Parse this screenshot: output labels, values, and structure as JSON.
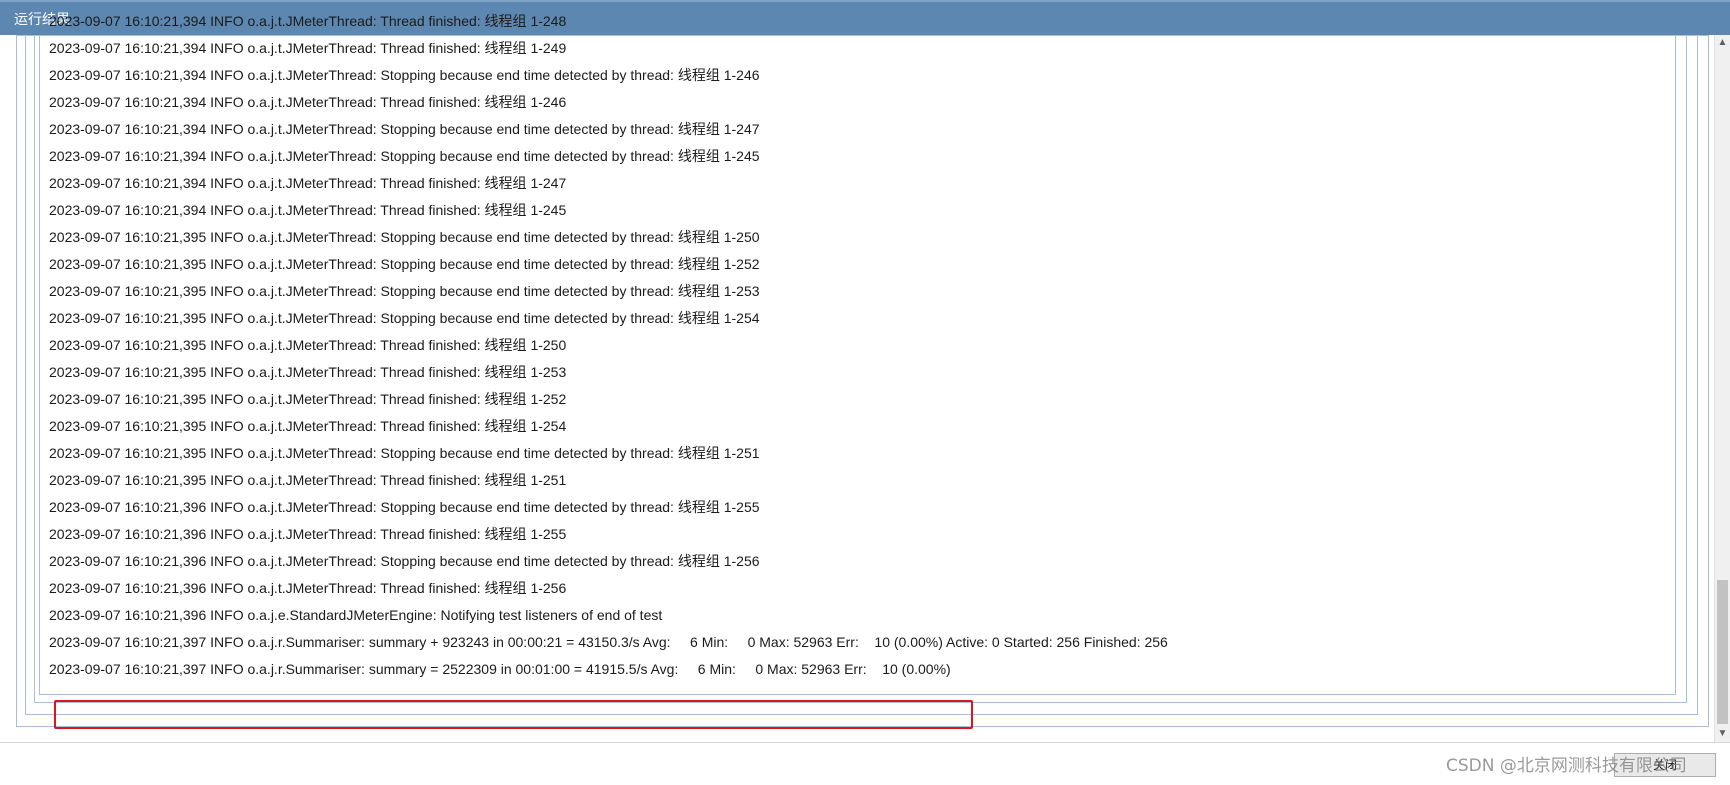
{
  "window": {
    "title": "运行结果"
  },
  "log_lines": [
    "2023-09-07 16:10:21,394 INFO o.a.j.t.JMeterThread: Thread finished: 线程组 1-248",
    "2023-09-07 16:10:21,394 INFO o.a.j.t.JMeterThread: Thread finished: 线程组 1-249",
    "2023-09-07 16:10:21,394 INFO o.a.j.t.JMeterThread: Stopping because end time detected by thread: 线程组 1-246",
    "2023-09-07 16:10:21,394 INFO o.a.j.t.JMeterThread: Thread finished: 线程组 1-246",
    "2023-09-07 16:10:21,394 INFO o.a.j.t.JMeterThread: Stopping because end time detected by thread: 线程组 1-247",
    "2023-09-07 16:10:21,394 INFO o.a.j.t.JMeterThread: Stopping because end time detected by thread: 线程组 1-245",
    "2023-09-07 16:10:21,394 INFO o.a.j.t.JMeterThread: Thread finished: 线程组 1-247",
    "2023-09-07 16:10:21,394 INFO o.a.j.t.JMeterThread: Thread finished: 线程组 1-245",
    "2023-09-07 16:10:21,395 INFO o.a.j.t.JMeterThread: Stopping because end time detected by thread: 线程组 1-250",
    "2023-09-07 16:10:21,395 INFO o.a.j.t.JMeterThread: Stopping because end time detected by thread: 线程组 1-252",
    "2023-09-07 16:10:21,395 INFO o.a.j.t.JMeterThread: Stopping because end time detected by thread: 线程组 1-253",
    "2023-09-07 16:10:21,395 INFO o.a.j.t.JMeterThread: Stopping because end time detected by thread: 线程组 1-254",
    "2023-09-07 16:10:21,395 INFO o.a.j.t.JMeterThread: Thread finished: 线程组 1-250",
    "2023-09-07 16:10:21,395 INFO o.a.j.t.JMeterThread: Thread finished: 线程组 1-253",
    "2023-09-07 16:10:21,395 INFO o.a.j.t.JMeterThread: Thread finished: 线程组 1-252",
    "2023-09-07 16:10:21,395 INFO o.a.j.t.JMeterThread: Thread finished: 线程组 1-254",
    "2023-09-07 16:10:21,395 INFO o.a.j.t.JMeterThread: Stopping because end time detected by thread: 线程组 1-251",
    "2023-09-07 16:10:21,395 INFO o.a.j.t.JMeterThread: Thread finished: 线程组 1-251",
    "2023-09-07 16:10:21,396 INFO o.a.j.t.JMeterThread: Stopping because end time detected by thread: 线程组 1-255",
    "2023-09-07 16:10:21,396 INFO o.a.j.t.JMeterThread: Thread finished: 线程组 1-255",
    "2023-09-07 16:10:21,396 INFO o.a.j.t.JMeterThread: Stopping because end time detected by thread: 线程组 1-256",
    "2023-09-07 16:10:21,396 INFO o.a.j.t.JMeterThread: Thread finished: 线程组 1-256",
    "2023-09-07 16:10:21,396 INFO o.a.j.e.StandardJMeterEngine: Notifying test listeners of end of test",
    "2023-09-07 16:10:21,397 INFO o.a.j.r.Summariser: summary + 923243 in 00:00:21 = 43150.3/s Avg:     6 Min:     0 Max: 52963 Err:    10 (0.00%) Active: 0 Started: 256 Finished: 256",
    "2023-09-07 16:10:21,397 INFO o.a.j.r.Summariser: summary = 2522309 in 00:01:00 = 41915.5/s Avg:     6 Min:     0 Max: 52963 Err:    10 (0.00%)"
  ],
  "footer": {
    "close_label": "关闭",
    "watermark": "CSDN @北京网测科技有限公司"
  },
  "scrollbar": {
    "up_arrow": "▲",
    "down_arrow": "▼"
  },
  "colors": {
    "titlebar": "#5b87b1",
    "highlight_border": "#e0141e",
    "frame_border": "#a7c0d8"
  }
}
